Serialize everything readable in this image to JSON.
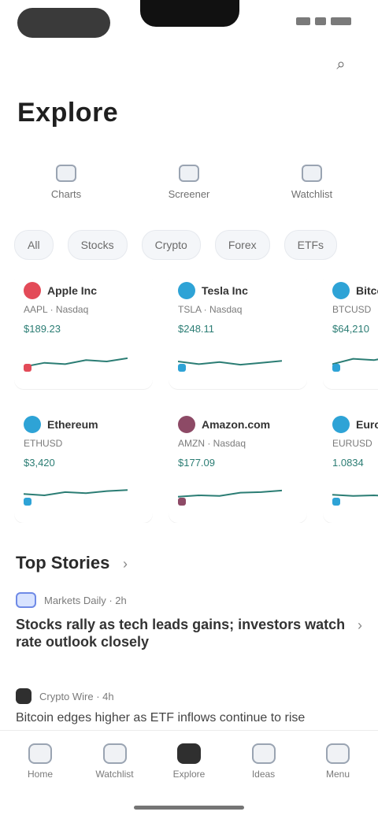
{
  "app": {
    "title": "Explore"
  },
  "topbar": {
    "action_icon": "search-icon"
  },
  "quick_actions": [
    {
      "label": "Charts",
      "icon": "chart-icon"
    },
    {
      "label": "Screener",
      "icon": "filter-icon"
    },
    {
      "label": "Watchlist",
      "icon": "star-icon"
    }
  ],
  "chips": [
    "All",
    "Stocks",
    "Crypto",
    "Forex",
    "ETFs"
  ],
  "cards": [
    {
      "name": "Apple Inc",
      "meta": "AAPL · Nasdaq",
      "price": "$189.23",
      "accent": "#e34b58",
      "trend": [
        0.3,
        0.45,
        0.4,
        0.55,
        0.5,
        0.62
      ]
    },
    {
      "name": "Tesla Inc",
      "meta": "TSLA · Nasdaq",
      "price": "$248.11",
      "accent": "#2ea3d6",
      "trend": [
        0.5,
        0.4,
        0.48,
        0.38,
        0.45,
        0.52
      ]
    },
    {
      "name": "Bitcoin",
      "meta": "BTCUSD",
      "price": "$64,210",
      "accent": "#2ea3d6",
      "trend": [
        0.4,
        0.6,
        0.55,
        0.7,
        0.65,
        0.72
      ]
    },
    {
      "name": "Ethereum",
      "meta": "ETHUSD",
      "price": "$3,420",
      "accent": "#2ea3d6",
      "trend": [
        0.55,
        0.5,
        0.62,
        0.58,
        0.66,
        0.7
      ]
    },
    {
      "name": "Amazon.com",
      "meta": "AMZN · Nasdaq",
      "price": "$177.09",
      "accent": "#8d4a66",
      "trend": [
        0.45,
        0.5,
        0.48,
        0.6,
        0.62,
        0.68
      ]
    },
    {
      "name": "Euro / Dollar",
      "meta": "EURUSD",
      "price": "1.0834",
      "accent": "#2ea3d6",
      "trend": [
        0.52,
        0.48,
        0.5,
        0.46,
        0.5,
        0.47
      ]
    }
  ],
  "news_section": {
    "title": "Top Stories",
    "more_icon": "chevron-right-icon",
    "items": [
      {
        "source": "Markets Daily · 2h",
        "headline": "Stocks rally as tech leads gains; investors watch rate outlook closely",
        "chevron_icon": "chevron-right-icon"
      },
      {
        "source": "Crypto Wire · 4h",
        "headline": "Bitcoin edges higher as ETF inflows continue to rise"
      }
    ]
  },
  "tabbar": [
    {
      "label": "Home",
      "icon": "home-icon",
      "active": false
    },
    {
      "label": "Watchlist",
      "icon": "list-icon",
      "active": false
    },
    {
      "label": "Explore",
      "icon": "compass-icon",
      "active": true
    },
    {
      "label": "Ideas",
      "icon": "bulb-icon",
      "active": false
    },
    {
      "label": "Menu",
      "icon": "menu-icon",
      "active": false
    }
  ]
}
